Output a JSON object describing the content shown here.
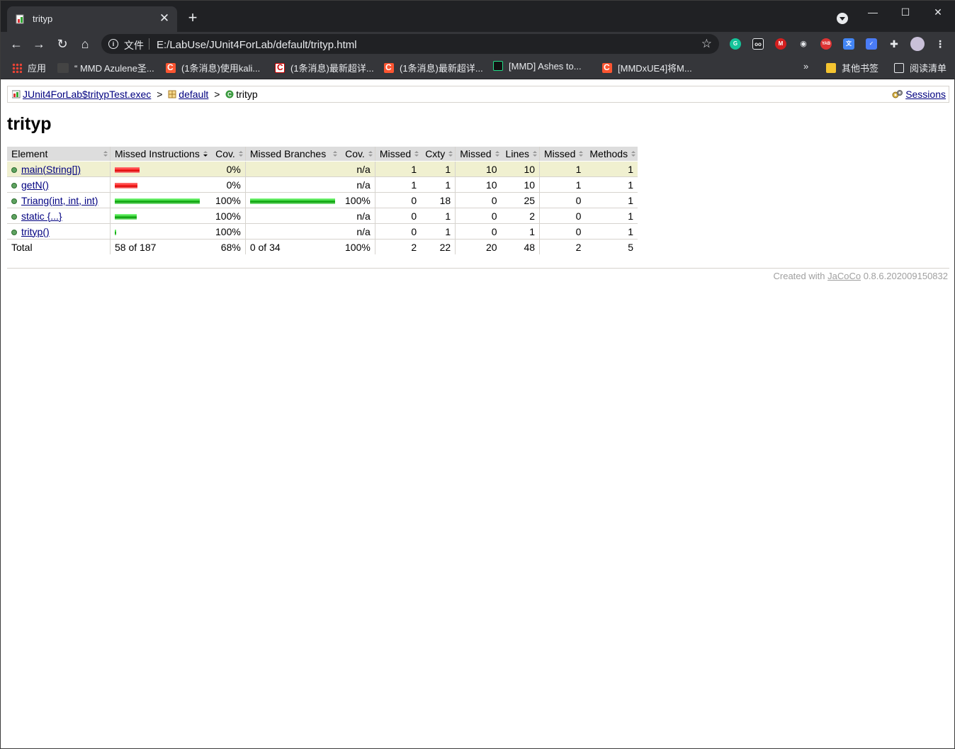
{
  "tab": {
    "title": "trityp",
    "close": "✕"
  },
  "window": {
    "minimize": "—",
    "maximize": "☐",
    "close": "✕",
    "new_tab": "+"
  },
  "toolbar": {
    "back": "←",
    "forward": "→",
    "reload": "↻",
    "home": "⌂",
    "scheme_label": "文件",
    "url": "E:/LabUse/JUnit4ForLab/default/trityp.html",
    "star": "☆"
  },
  "bookmarks": {
    "apps": "应用",
    "items": [
      "“ MMD Azulene圣...",
      "(1条消息)使用kali...",
      "(1条消息)最新超详...",
      "(1条消息)最新超详...",
      "[MMD] Ashes to...",
      "[MMDxUE4]将M..."
    ],
    "more": "»",
    "other": "其他书签",
    "reading_list": "阅读清单"
  },
  "breadcrumb": {
    "session_file": "JUnit4ForLab$tritypTest.exec",
    "package": "default",
    "class": "trityp",
    "sep": ">",
    "sessions": "Sessions"
  },
  "page": {
    "title": "trityp"
  },
  "table": {
    "headers": [
      "Element",
      "Missed Instructions",
      "Cov.",
      "Missed Branches",
      "Cov.",
      "Missed",
      "Cxty",
      "Missed",
      "Lines",
      "Missed",
      "Methods"
    ],
    "rows": [
      {
        "element": "main(String[])",
        "instr_missed_frac": 1.0,
        "instr_covered_frac": 0.0,
        "instr_cov": "0%",
        "branch_missed_frac": 0,
        "branch_covered_frac": 0,
        "branch_cov": "n/a",
        "cx_missed": "1",
        "cxty": "1",
        "lines_missed": "10",
        "lines": "10",
        "methods_missed": "1",
        "methods": "1"
      },
      {
        "element": "getN()",
        "instr_missed_frac": 1.0,
        "instr_covered_frac": 0.0,
        "instr_cov": "0%",
        "branch_missed_frac": 0,
        "branch_covered_frac": 0,
        "branch_cov": "n/a",
        "cx_missed": "1",
        "cxty": "1",
        "lines_missed": "10",
        "lines": "10",
        "methods_missed": "1",
        "methods": "1"
      },
      {
        "element": "Triang(int, int, int)",
        "instr_missed_frac": 0.0,
        "instr_covered_frac": 1.0,
        "instr_cov": "100%",
        "branch_missed_frac": 0.0,
        "branch_covered_frac": 1.0,
        "branch_cov": "100%",
        "cx_missed": "0",
        "cxty": "18",
        "lines_missed": "0",
        "lines": "25",
        "methods_missed": "0",
        "methods": "1"
      },
      {
        "element": "static {...}",
        "instr_missed_frac": 0.0,
        "instr_covered_frac": 1.0,
        "instr_cov": "100%",
        "branch_missed_frac": 0,
        "branch_covered_frac": 0,
        "branch_cov": "n/a",
        "cx_missed": "0",
        "cxty": "1",
        "lines_missed": "0",
        "lines": "2",
        "methods_missed": "0",
        "methods": "1"
      },
      {
        "element": "trityp()",
        "instr_missed_frac": 0.0,
        "instr_covered_frac": 1.0,
        "instr_cov": "100%",
        "branch_missed_frac": 0,
        "branch_covered_frac": 0,
        "branch_cov": "n/a",
        "cx_missed": "0",
        "cxty": "1",
        "lines_missed": "0",
        "lines": "1",
        "methods_missed": "0",
        "methods": "1"
      }
    ],
    "bar_widths_rel": [
      0.29,
      0.27,
      1.0,
      0.26,
      0.02
    ],
    "total": {
      "label": "Total",
      "instr": "58 of 187",
      "instr_cov": "68%",
      "branch": "0 of 34",
      "branch_cov": "100%",
      "cx_missed": "2",
      "cxty": "22",
      "lines_missed": "20",
      "lines": "48",
      "methods_missed": "2",
      "methods": "5"
    }
  },
  "footer": {
    "prefix": "Created with",
    "link": "JaCoCo",
    "version": "0.8.6.202009150832"
  },
  "colors": {
    "missed_bar": "#ff3333",
    "covered_bar": "#33cc33",
    "header_bg": "#dddddd",
    "highlight_row": "#f0f0d0",
    "link": "#000080"
  }
}
